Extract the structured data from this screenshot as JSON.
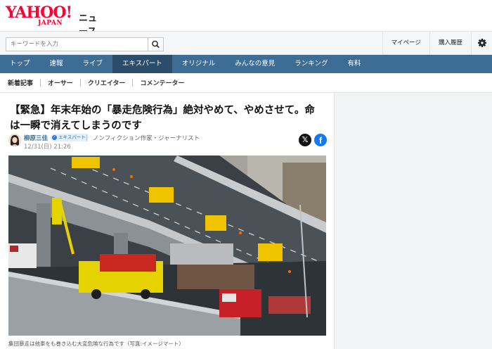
{
  "header": {
    "logo_text": "YAHOO!",
    "logo_sub": "JAPAN",
    "service": "ニュース"
  },
  "search": {
    "placeholder": "キーワードを入力",
    "links": [
      "マイページ",
      "購入履歴"
    ]
  },
  "nav": {
    "items": [
      "トップ",
      "速報",
      "ライブ",
      "エキスパート",
      "オリジナル",
      "みんなの意見",
      "ランキング",
      "有料"
    ],
    "active": "エキスパート"
  },
  "subnav": {
    "items": [
      "新着記事",
      "オーサー",
      "クリエイター",
      "コメンテーター"
    ]
  },
  "article": {
    "title": "【緊急】年末年始の「暴走危険行為」絶対やめて、やめさせて。命は一瞬で消えてしまうのです",
    "author": "柳原三佳",
    "badge": "エキスパート",
    "role": "ノンフィクション作家・ジャーナリスト",
    "date": "12/31(日) 21:26",
    "caption": "集団暴走は他車をも巻き込む大変危険な行為です（写真:イメージマート）"
  },
  "colors": {
    "brand": "#ff0033",
    "nav_bg": "#3d6c94",
    "nav_active": "#2a4d6b",
    "link": "#2a6aa8"
  }
}
